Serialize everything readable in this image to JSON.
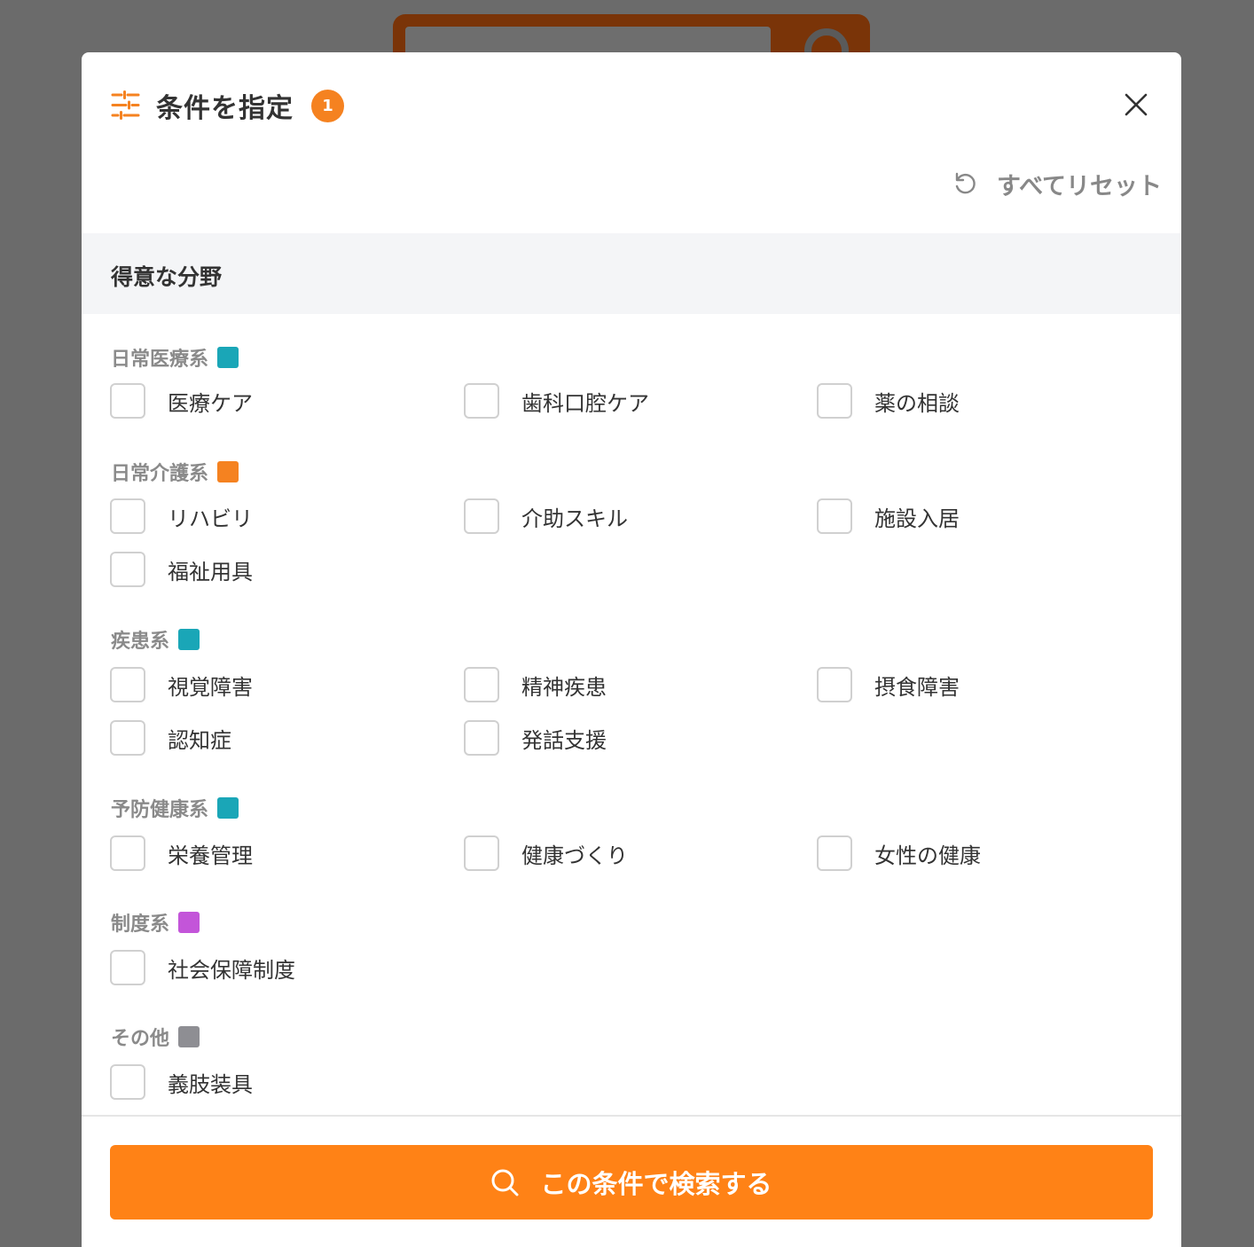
{
  "modal": {
    "title": "条件を指定",
    "count": "1",
    "reset_label": "すべてリセット"
  },
  "section": {
    "title": "得意な分野"
  },
  "groups": [
    {
      "label": "日常医療系",
      "color": "#1aa6b7",
      "options": [
        "医療ケア",
        "歯科口腔ケア",
        "薬の相談"
      ]
    },
    {
      "label": "日常介護系",
      "color": "#f58220",
      "options": [
        "リハビリ",
        "介助スキル",
        "施設入居",
        "福祉用具"
      ]
    },
    {
      "label": "疾患系",
      "color": "#1aa6b7",
      "options": [
        "視覚障害",
        "精神疾患",
        "摂食障害",
        "認知症",
        "発話支援"
      ]
    },
    {
      "label": "予防健康系",
      "color": "#1aa6b7",
      "options": [
        "栄養管理",
        "健康づくり",
        "女性の健康"
      ]
    },
    {
      "label": "制度系",
      "color": "#c355d9",
      "options": [
        "社会保障制度"
      ]
    },
    {
      "label": "その他",
      "color": "#8e8e93",
      "options": [
        "義肢装具"
      ]
    }
  ],
  "footer": {
    "search_label": "この条件で検索する"
  },
  "colors": {
    "accent": "#f58220",
    "button": "#ff8216"
  },
  "icons": {
    "header": "filter-sliders-icon",
    "close": "close-icon",
    "reset": "reset-icon",
    "search": "search-icon"
  }
}
